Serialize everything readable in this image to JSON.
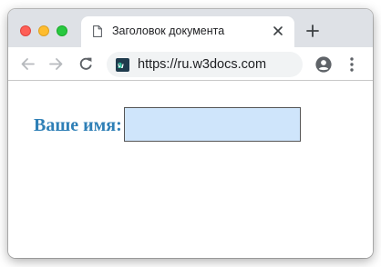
{
  "browser": {
    "tab": {
      "title": "Заголовок документа"
    },
    "address_bar": {
      "url": "https://ru.w3docs.com",
      "favicon_text": "w3"
    }
  },
  "page": {
    "form": {
      "name_label": "Ваше имя:",
      "name_input_value": ""
    }
  },
  "colors": {
    "label": "#2e7fb6",
    "input_background": "#cfe5fb",
    "tab_strip": "#dee1e6",
    "omnibox": "#f1f3f4"
  },
  "icons": {
    "window_controls": [
      "close-icon",
      "minimize-icon",
      "maximize-icon"
    ],
    "tab": [
      "document-icon",
      "close-icon"
    ],
    "toolbar": [
      "back-arrow-icon",
      "forward-arrow-icon",
      "reload-icon",
      "profile-icon",
      "kebab-menu-icon"
    ],
    "new_tab": "plus-icon"
  }
}
